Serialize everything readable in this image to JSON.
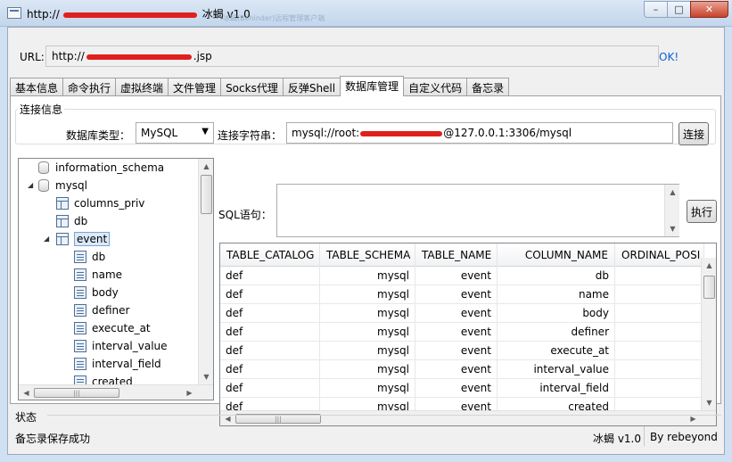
{
  "window": {
    "title_prefix": "http://",
    "title_suffix": "冰蝎 v1.0",
    "ghost_text": "冰蝎(Behinder)远程管理客户端",
    "minimize": "–",
    "maximize": "□",
    "close": "✕"
  },
  "url_bar": {
    "label": "URL:",
    "value_prefix": "http://",
    "value_suffix": ".jsp",
    "ok": "OK!"
  },
  "tabs": [
    {
      "label": "基本信息",
      "active": false
    },
    {
      "label": "命令执行",
      "active": false
    },
    {
      "label": "虚拟终端",
      "active": false
    },
    {
      "label": "文件管理",
      "active": false
    },
    {
      "label": "Socks代理",
      "active": false
    },
    {
      "label": "反弹Shell",
      "active": false
    },
    {
      "label": "数据库管理",
      "active": true
    },
    {
      "label": "自定义代码",
      "active": false
    },
    {
      "label": "备忘录",
      "active": false
    }
  ],
  "connection": {
    "group_label": "连接信息",
    "db_type_label": "数据库类型：",
    "db_type_value": "MySQL",
    "conn_label": "连接字符串：",
    "conn_prefix": "mysql://root:",
    "conn_suffix": "@127.0.0.1:3306/mysql",
    "connect_button": "连接"
  },
  "tree": {
    "items": [
      {
        "label": "information_schema",
        "kind": "db",
        "depth": 0
      },
      {
        "label": "mysql",
        "kind": "db",
        "depth": 0
      },
      {
        "label": "columns_priv",
        "kind": "table",
        "depth": 1
      },
      {
        "label": "db",
        "kind": "table",
        "depth": 1
      },
      {
        "label": "event",
        "kind": "table",
        "depth": 1
      },
      {
        "label": "db",
        "kind": "column",
        "depth": 2
      },
      {
        "label": "name",
        "kind": "column",
        "depth": 2
      },
      {
        "label": "body",
        "kind": "column",
        "depth": 2
      },
      {
        "label": "definer",
        "kind": "column",
        "depth": 2
      },
      {
        "label": "execute_at",
        "kind": "column",
        "depth": 2
      },
      {
        "label": "interval_value",
        "kind": "column",
        "depth": 2
      },
      {
        "label": "interval_field",
        "kind": "column",
        "depth": 2
      },
      {
        "label": "created",
        "kind": "column",
        "depth": 2
      }
    ],
    "selected_index": 4
  },
  "sql": {
    "label": "SQL语句：",
    "value": "",
    "execute_button": "执行"
  },
  "results": {
    "columns": [
      "TABLE_CATALOG",
      "TABLE_SCHEMA",
      "TABLE_NAME",
      "COLUMN_NAME",
      "ORDINAL_POSI"
    ],
    "rows": [
      [
        "def",
        "mysql",
        "event",
        "db",
        ""
      ],
      [
        "def",
        "mysql",
        "event",
        "name",
        ""
      ],
      [
        "def",
        "mysql",
        "event",
        "body",
        ""
      ],
      [
        "def",
        "mysql",
        "event",
        "definer",
        ""
      ],
      [
        "def",
        "mysql",
        "event",
        "execute_at",
        ""
      ],
      [
        "def",
        "mysql",
        "event",
        "interval_value",
        ""
      ],
      [
        "def",
        "mysql",
        "event",
        "interval_field",
        ""
      ],
      [
        "def",
        "mysql",
        "event",
        "created",
        ""
      ]
    ]
  },
  "status": {
    "label": "状态",
    "message": "备忘录保存成功",
    "version": "冰蝎 v1.0",
    "author": "By rebeyond"
  },
  "colors": {
    "link": "#0a60d8",
    "redaction": "#e0201c",
    "selection": "#dce9f9"
  }
}
